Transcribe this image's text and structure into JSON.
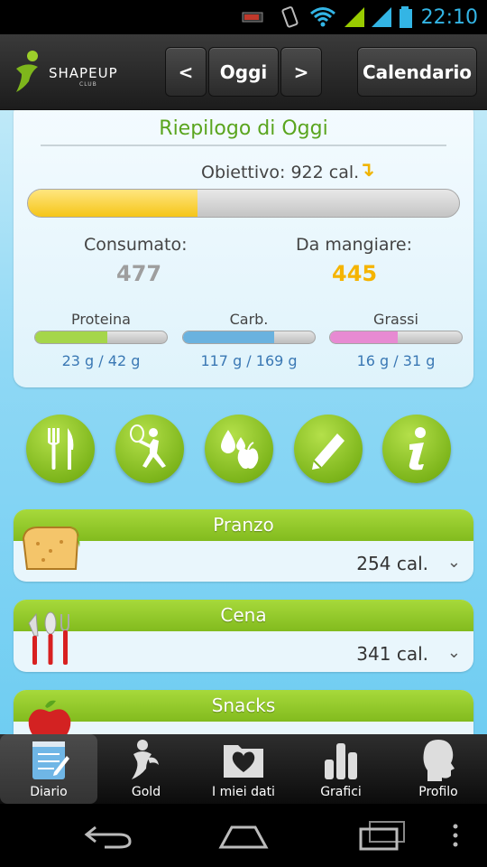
{
  "status_bar": {
    "time": "22:10"
  },
  "header": {
    "logo_text": "SHAPEUP",
    "logo_sub": "CLUB",
    "prev_label": "<",
    "today_label": "Oggi",
    "next_label": ">",
    "calendar_label": "Calendario"
  },
  "summary": {
    "title": "Riepilogo di Oggi",
    "goal_text": "Obiettivo: 922 cal.",
    "goal_progress": 0.394,
    "consumed_label": "Consumato:",
    "consumed_value": "477",
    "to_eat_label": "Da mangiare:",
    "to_eat_value": "445",
    "macros": [
      {
        "label": "Proteina",
        "value": "23 g / 42 g",
        "fraction": 0.548,
        "color": "#a5d64a"
      },
      {
        "label": "Carb.",
        "value": "117 g / 169 g",
        "fraction": 0.692,
        "color": "#6ab2df"
      },
      {
        "label": "Grassi",
        "value": "16 g / 31 g",
        "fraction": 0.516,
        "color": "#e78ad2"
      }
    ]
  },
  "actions": [
    {
      "icon": "fork-knife-icon"
    },
    {
      "icon": "tennis-player-icon"
    },
    {
      "icon": "water-apple-icon"
    },
    {
      "icon": "pencil-icon"
    },
    {
      "icon": "info-icon"
    }
  ],
  "meals": [
    {
      "name": "Pranzo",
      "calories": "254 cal.",
      "icon": "sandwich-icon"
    },
    {
      "name": "Cena",
      "calories": "341 cal.",
      "icon": "cutlery-icon"
    },
    {
      "name": "Snacks",
      "calories": "",
      "icon": "apple-icon"
    }
  ],
  "tabs": [
    {
      "label": "Diario",
      "icon": "notepad-icon",
      "active": true
    },
    {
      "label": "Gold",
      "icon": "gold-person-icon",
      "active": false
    },
    {
      "label": "I miei dati",
      "icon": "heart-folder-icon",
      "active": false
    },
    {
      "label": "Grafici",
      "icon": "bar-chart-icon",
      "active": false
    },
    {
      "label": "Profilo",
      "icon": "head-profile-icon",
      "active": false
    }
  ],
  "colors": {
    "accent_green": "#7eb61c",
    "goal_yellow": "#f5c518",
    "consumed_gray": "#9e9e9e",
    "status_blue": "#33b5e5"
  }
}
